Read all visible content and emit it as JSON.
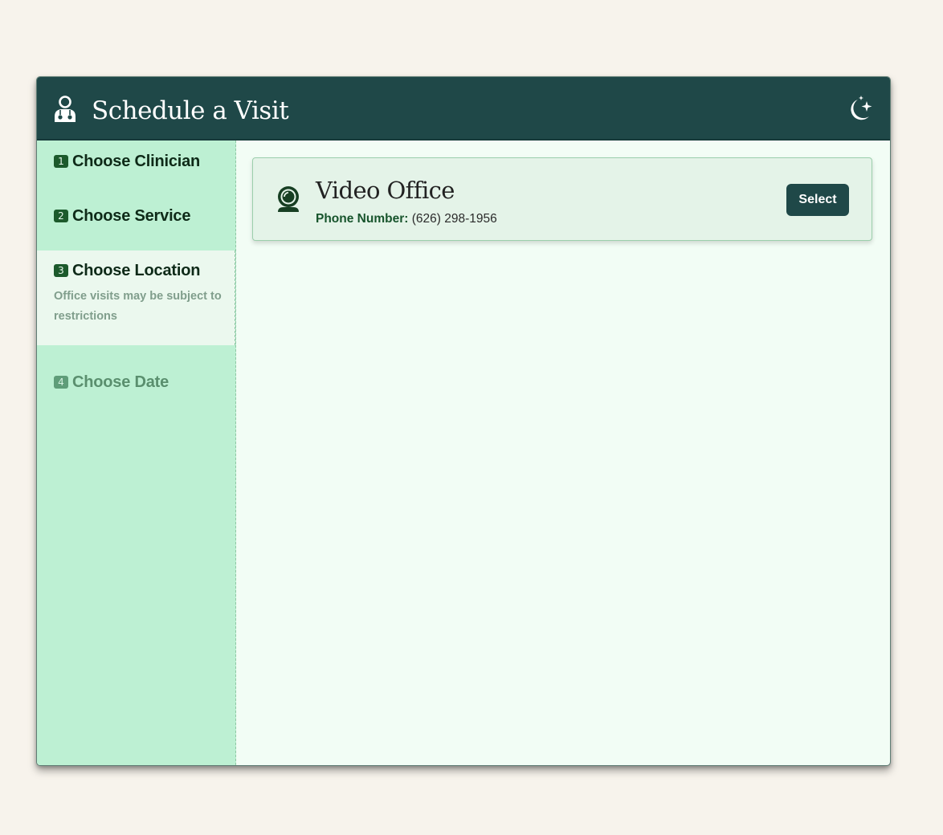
{
  "header": {
    "title": "Schedule a Visit",
    "icons": {
      "left": "doctor-icon",
      "right": "moon-stars-icon"
    }
  },
  "steps": [
    {
      "number": "1",
      "label": "Choose Clinician",
      "state": "completed"
    },
    {
      "number": "2",
      "label": "Choose Service",
      "state": "completed"
    },
    {
      "number": "3",
      "label": "Choose Location",
      "state": "active",
      "note": "Office visits may be subject to restrictions"
    },
    {
      "number": "4",
      "label": "Choose Date",
      "state": "disabled"
    }
  ],
  "locations": [
    {
      "icon": "webcam-icon",
      "name": "Video Office",
      "phone_label": "Phone Number:",
      "phone_value": "(626) 298-1956",
      "button_label": "Select"
    }
  ],
  "colors": {
    "page_background": "#f7f3ec",
    "header": "#1f4848",
    "sidebar": "#bdf0d3",
    "active_step": "#ebf8ee",
    "content": "#f2fdf5",
    "card": "#e4f3e8",
    "accent_green": "#1c5a2c"
  }
}
